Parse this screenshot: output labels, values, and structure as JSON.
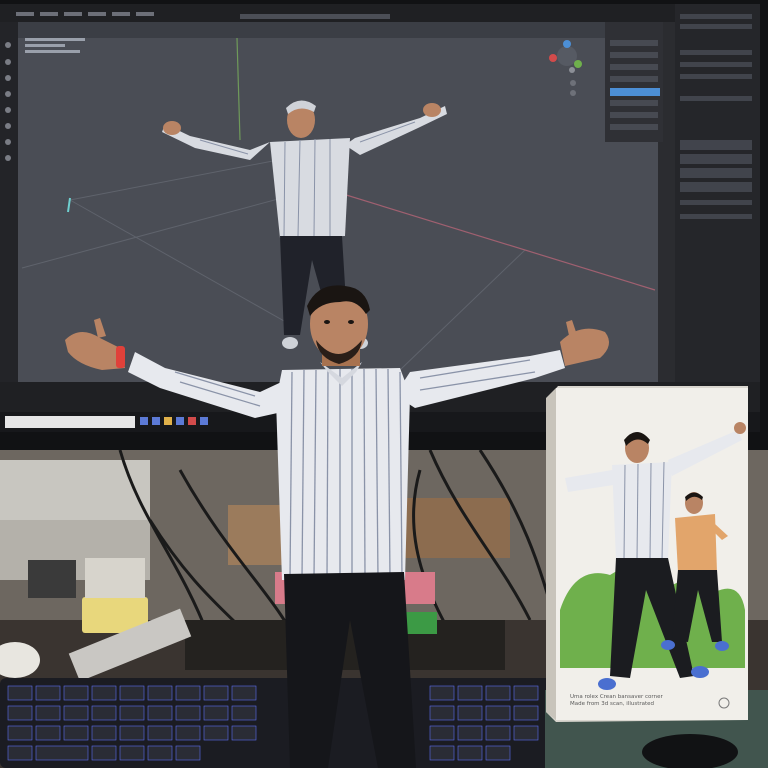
{
  "colors": {
    "wall": "#8f8a82",
    "desk": "#3a3430",
    "monitor_bezel": "#111214",
    "viewport": "#4a4d55",
    "panel": "#2b2c30",
    "panel_dark": "#1f2023",
    "highlight_blue": "#4c8fd6",
    "box_white": "#f1efea",
    "shirt": "#e7e9ee",
    "stripe": "#8a93a8",
    "pants": "#15161a",
    "skin": "#b98464",
    "hair": "#1a1512",
    "keyboard": "#1b1c22",
    "key": "#2a2c35",
    "key_glow": "#5a6df0",
    "bush": "#6fb04c",
    "orange_shirt": "#e2a56b"
  },
  "icons": [
    "axis-gizmo-icon",
    "wristband-icon",
    "box-logo-icon"
  ],
  "box": {
    "title_line": "Uma rolex Crean bansaver corner",
    "sub_line": "Made from 3d scan, illustrated"
  }
}
